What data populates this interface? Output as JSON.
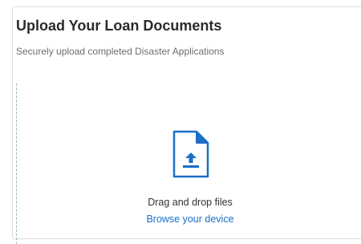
{
  "upload": {
    "title": "Upload Your Loan Documents",
    "subtitle": "Securely upload completed Disaster Applications",
    "dropzone": {
      "icon": "file-upload-icon",
      "drag_text": "Drag and drop files",
      "browse_label": "Browse your device"
    }
  },
  "colors": {
    "accent": "#1b6fc7",
    "dropzone_border": "#9fb8c8"
  }
}
